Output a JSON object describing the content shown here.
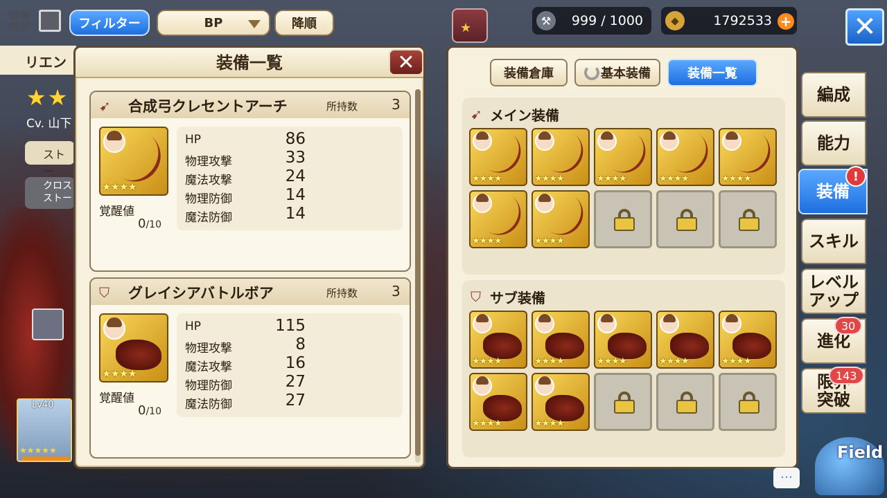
{
  "toolbar": {
    "filter_label": "フィルター",
    "sort_value": "BP",
    "order_label": "降順",
    "stamina": "999 / 1000",
    "coins": "1792533",
    "coin_plus": "+"
  },
  "background_panel": {
    "character_name": "リエン",
    "stars": "★★",
    "cv": "Cv. 山下",
    "story_btn": "ストー",
    "cross_story_btn": "クロス\nストー",
    "portrait_level": "Lv40",
    "portrait_stars": "★★★★★"
  },
  "equip_list_modal": {
    "title": "装備一覧",
    "close": "✕",
    "items": [
      {
        "icon": "bow-icon",
        "name": "合成弓クレセントアーチ",
        "owned_label": "所持数",
        "owned_count": "3",
        "stars": "★★★★",
        "awaken_label": "覚醒値",
        "awaken_value": "0",
        "awaken_max": "/10",
        "stats": [
          {
            "label": "HP",
            "value": "86"
          },
          {
            "label": "物理攻撃",
            "value": "33"
          },
          {
            "label": "魔法攻撃",
            "value": "24"
          },
          {
            "label": "物理防御",
            "value": "14"
          },
          {
            "label": "魔法防御",
            "value": "14"
          }
        ]
      },
      {
        "icon": "shield-icon",
        "name": "グレイシアバトルボア",
        "owned_label": "所持数",
        "owned_count": "3",
        "stars": "★★★★",
        "awaken_label": "覚醒値",
        "awaken_value": "0",
        "awaken_max": "/10",
        "stats": [
          {
            "label": "HP",
            "value": "115"
          },
          {
            "label": "物理攻撃",
            "value": "8"
          },
          {
            "label": "魔法攻撃",
            "value": "16"
          },
          {
            "label": "物理防御",
            "value": "27"
          },
          {
            "label": "魔法防御",
            "value": "27"
          }
        ]
      }
    ]
  },
  "equip_panel": {
    "storage_btn": "装備倉庫",
    "basic_btn": "基本装備",
    "list_btn": "装備一覧",
    "main_title": "メイン装備",
    "sub_title": "サブ装備",
    "slot_stars": "★★★★"
  },
  "side_tabs": {
    "formation": "編成",
    "ability": "能力",
    "equipment": "装備",
    "skill": "スキル",
    "level_up": "レベル\nアップ",
    "evolve": "進化",
    "limit_break": "限界\n突破",
    "evolve_badge": "30",
    "limit_badge": "143",
    "alert": "!",
    "field_label": "Field"
  },
  "chat": "…"
}
